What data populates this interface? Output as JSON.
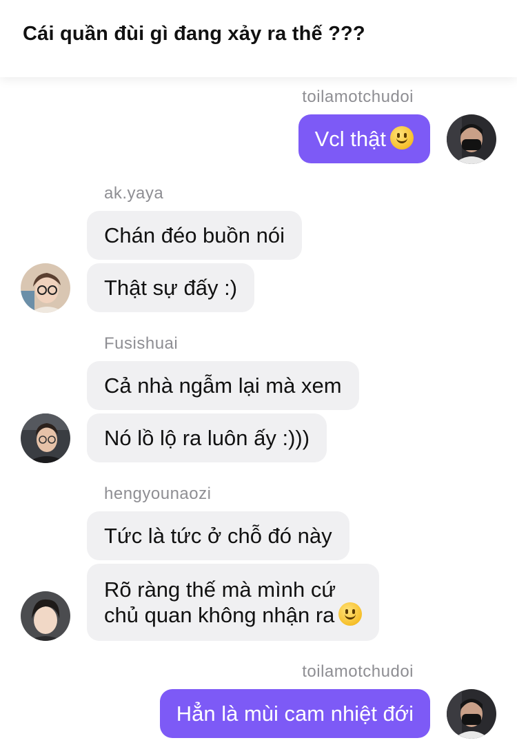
{
  "header": {
    "title": "Cái quần đùi gì đang xảy ra thế ???"
  },
  "messages": [
    {
      "sender": "toilamotchudoi",
      "lines": [
        "Vcl thật"
      ],
      "emoji": "slightly-smiling-face"
    },
    {
      "sender": "ak.yaya",
      "lines": [
        "Chán đéo buồn nói",
        "Thật sự đấy :)"
      ]
    },
    {
      "sender": "Fusishuai",
      "lines": [
        "Cả nhà ngẫm lại mà xem",
        "Nó lồ lộ ra luôn ấy :)))"
      ]
    },
    {
      "sender": "hengyounaozi",
      "lines": [
        "Tức là tức ở chỗ đó này",
        "Rõ ràng thế mà mình cứ",
        "chủ quan không nhận ra"
      ],
      "emoji": "slightly-smiling-face"
    },
    {
      "sender": "toilamotchudoi",
      "lines": [
        "Hẳn là mùi cam nhiệt đới"
      ]
    }
  ],
  "colors": {
    "outgoing_bubble": "#7d5af6",
    "incoming_bubble": "#f0f0f2",
    "sender_name": "#8e8e93"
  }
}
